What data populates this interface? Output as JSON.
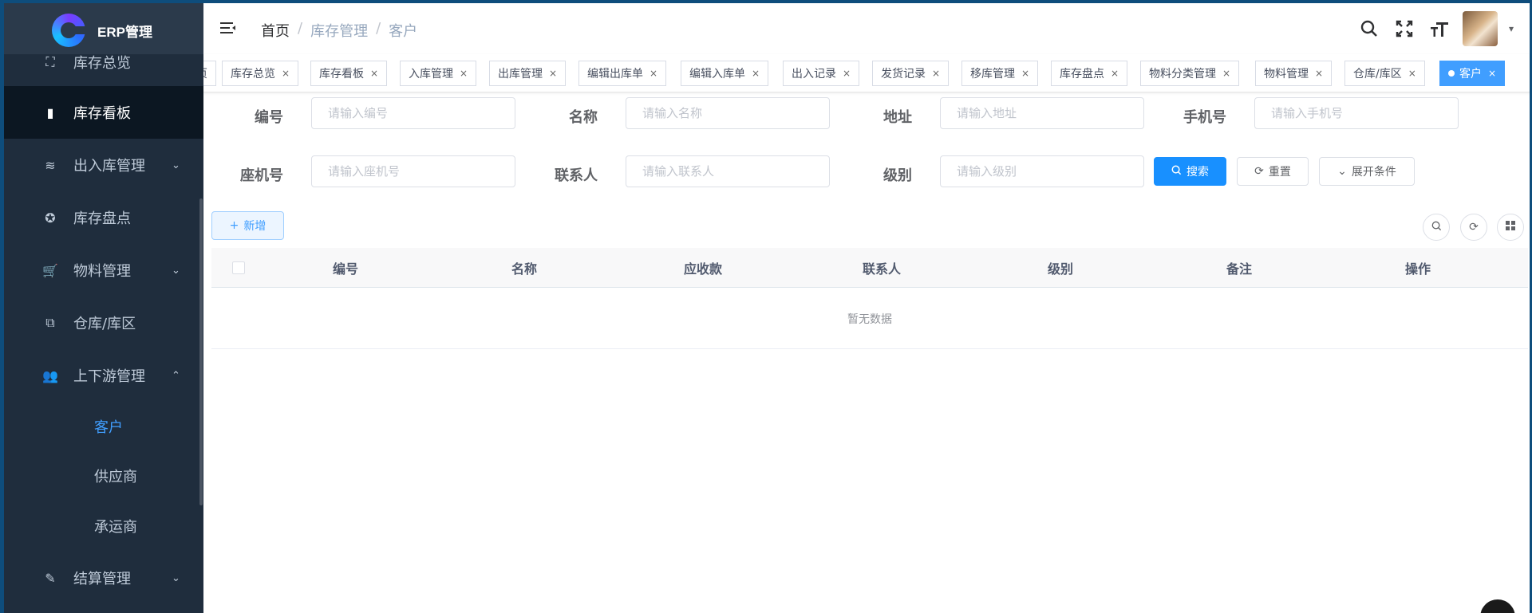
{
  "app": {
    "title": "ERP管理"
  },
  "sidebar": {
    "items": [
      {
        "label": "库存总览",
        "icon": "chart-board-icon",
        "glyph": "⛶",
        "chevron": ""
      },
      {
        "label": "库存看板",
        "icon": "bar-chart-icon",
        "glyph": "▮",
        "chevron": ""
      },
      {
        "label": "出入库管理",
        "icon": "layers-icon",
        "glyph": "≋",
        "chevron": "⌄"
      },
      {
        "label": "库存盘点",
        "icon": "lifebuoy-icon",
        "glyph": "✪",
        "chevron": ""
      },
      {
        "label": "物料管理",
        "icon": "cart-icon",
        "glyph": "🛒",
        "chevron": "⌄"
      },
      {
        "label": "仓库/库区",
        "icon": "puzzle-icon",
        "glyph": "⧉",
        "chevron": ""
      },
      {
        "label": "上下游管理",
        "icon": "users-icon",
        "glyph": "👥",
        "chevron": "⌃"
      },
      {
        "label": "结算管理",
        "icon": "edit-icon",
        "glyph": "✎",
        "chevron": "⌄"
      }
    ],
    "subitems": [
      {
        "label": "客户"
      },
      {
        "label": "供应商"
      },
      {
        "label": "承运商"
      }
    ]
  },
  "navbar": {
    "breadcrumb": [
      "首页",
      "库存管理",
      "客户"
    ],
    "separator": "/"
  },
  "tags": [
    {
      "label": "页",
      "close": ""
    },
    {
      "label": "库存总览",
      "close": "×"
    },
    {
      "label": "库存看板",
      "close": "×"
    },
    {
      "label": "入库管理",
      "close": "×"
    },
    {
      "label": "出库管理",
      "close": "×"
    },
    {
      "label": "编辑出库单",
      "close": "×"
    },
    {
      "label": "编辑入库单",
      "close": "×"
    },
    {
      "label": "出入记录",
      "close": "×"
    },
    {
      "label": "发货记录",
      "close": "×"
    },
    {
      "label": "移库管理",
      "close": "×"
    },
    {
      "label": "库存盘点",
      "close": "×"
    },
    {
      "label": "物料分类管理",
      "close": "×"
    },
    {
      "label": "物料管理",
      "close": "×"
    },
    {
      "label": "仓库/库区",
      "close": "×"
    },
    {
      "label": "客户",
      "close": "×"
    }
  ],
  "form": {
    "fields": [
      {
        "label": "编号",
        "placeholder": "请输入编号"
      },
      {
        "label": "名称",
        "placeholder": "请输入名称"
      },
      {
        "label": "地址",
        "placeholder": "请输入地址"
      },
      {
        "label": "手机号",
        "placeholder": "请输入手机号"
      },
      {
        "label": "座机号",
        "placeholder": "请输入座机号"
      },
      {
        "label": "联系人",
        "placeholder": "请输入联系人"
      },
      {
        "label": "级别",
        "placeholder": "请输入级别"
      }
    ],
    "search_label": "搜索",
    "reset_label": "重置",
    "expand_label": "展开条件"
  },
  "toolbar": {
    "add_label": "新增"
  },
  "table": {
    "columns": [
      "编号",
      "名称",
      "应收款",
      "联系人",
      "级别",
      "备注",
      "操作"
    ],
    "empty_text": "暂无数据"
  },
  "colors": {
    "primary": "#1890ff",
    "sidebar_bg": "#1f2d3d",
    "active_link": "#409eff"
  }
}
